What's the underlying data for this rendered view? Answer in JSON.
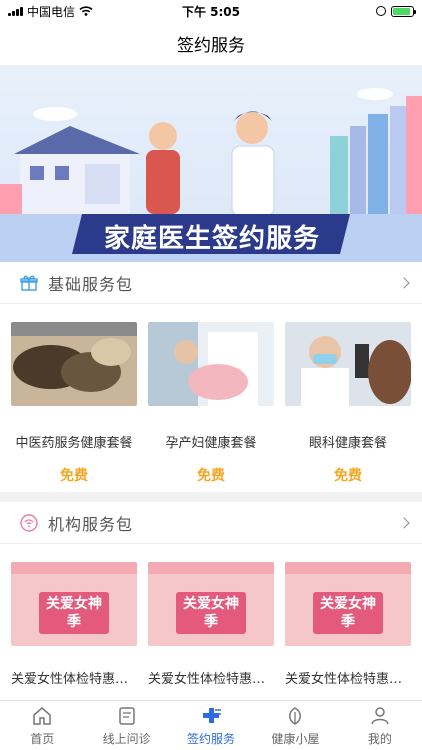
{
  "status": {
    "carrier": "中国电信",
    "time": "下午 5:05",
    "battery_level": 0.9
  },
  "nav": {
    "title": "签约服务"
  },
  "banner": {
    "text": "家庭医生签约服务"
  },
  "basic_section": {
    "title": "基础服务包",
    "items": [
      {
        "name": "中医药服务健康套餐",
        "price": "免费"
      },
      {
        "name": "孕产妇健康套餐",
        "price": "免费"
      },
      {
        "name": "眼科健康套餐",
        "price": "免费"
      }
    ]
  },
  "org_section": {
    "title": "机构服务包",
    "items": [
      {
        "name": "关爱女性体检特惠套餐",
        "poster": "关爱女神季"
      },
      {
        "name": "关爱女性体检特惠套餐",
        "poster": "关爱女神季"
      },
      {
        "name": "关爱女性体检特惠套餐",
        "poster": "关爱女神季"
      }
    ]
  },
  "tabs": [
    {
      "label": "首页",
      "icon": "home-icon"
    },
    {
      "label": "线上问诊",
      "icon": "consult-icon"
    },
    {
      "label": "签约服务",
      "icon": "sign-service-icon"
    },
    {
      "label": "健康小屋",
      "icon": "leaf-icon"
    },
    {
      "label": "我的",
      "icon": "user-icon"
    }
  ]
}
